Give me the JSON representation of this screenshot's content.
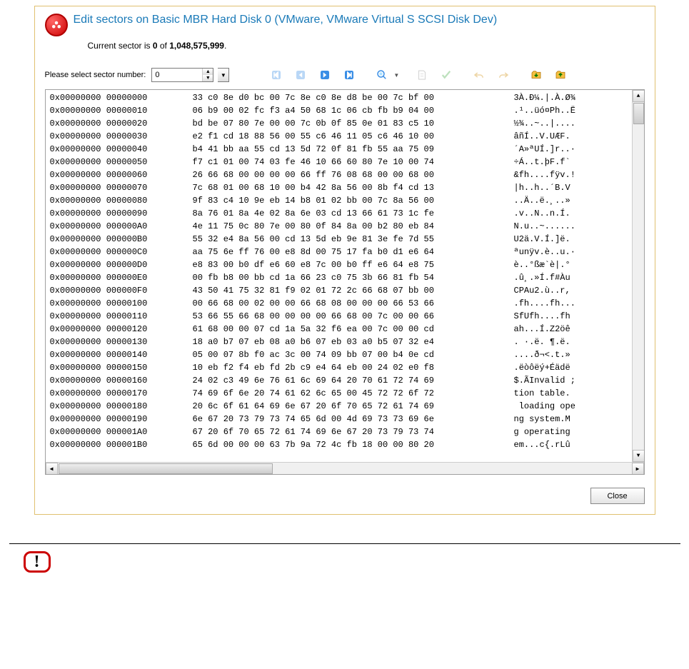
{
  "title": "Edit sectors on Basic MBR Hard Disk 0 (VMware, VMware Virtual S SCSI Disk Dev)",
  "subhead_prefix": "Current sector is ",
  "current_sector": "0",
  "subhead_middle": " of ",
  "total_sectors": "1,048,575,999",
  "subhead_suffix": ".",
  "sector_label": "Please select sector number:",
  "sector_value": "0",
  "close_label": "Close",
  "toolbar": {
    "first": "first-sector",
    "prev": "prev-sector",
    "next": "next-sector",
    "last": "last-sector",
    "search": "search",
    "edit": "edit",
    "apply": "apply",
    "undo": "undo",
    "redo": "redo",
    "load": "load-from-file",
    "save": "save-to-file"
  },
  "hex_rows": [
    {
      "addr": "0x00000000 00000000",
      "hex": "33 c0 8e d0 bc 00 7c 8e c0 8e d8 be 00 7c bf 00",
      "asc": "3À.Ð¼.|.À.Ø¾"
    },
    {
      "addr": "0x00000000 00000010",
      "hex": "06 b9 00 02 fc f3 a4 50 68 1c 06 cb fb b9 04 00",
      "asc": ".¹..üó¤Ph..Ë"
    },
    {
      "addr": "0x00000000 00000020",
      "hex": "bd be 07 80 7e 00 00 7c 0b 0f 85 0e 01 83 c5 10",
      "asc": "½¾..~..|...."
    },
    {
      "addr": "0x00000000 00000030",
      "hex": "e2 f1 cd 18 88 56 00 55 c6 46 11 05 c6 46 10 00",
      "asc": "âñÍ..V.UÆF."
    },
    {
      "addr": "0x00000000 00000040",
      "hex": "b4 41 bb aa 55 cd 13 5d 72 0f 81 fb 55 aa 75 09",
      "asc": "´A»ªUÍ.]r..·"
    },
    {
      "addr": "0x00000000 00000050",
      "hex": "f7 c1 01 00 74 03 fe 46 10 66 60 80 7e 10 00 74",
      "asc": "÷Á..t.þF.f`"
    },
    {
      "addr": "0x00000000 00000060",
      "hex": "26 66 68 00 00 00 00 66 ff 76 08 68 00 00 68 00",
      "asc": "&fh....fÿv.!"
    },
    {
      "addr": "0x00000000 00000070",
      "hex": "7c 68 01 00 68 10 00 b4 42 8a 56 00 8b f4 cd 13",
      "asc": "|h..h..´B.V"
    },
    {
      "addr": "0x00000000 00000080",
      "hex": "9f 83 c4 10 9e eb 14 b8 01 02 bb 00 7c 8a 56 00",
      "asc": "..Ä..ë.¸..»"
    },
    {
      "addr": "0x00000000 00000090",
      "hex": "8a 76 01 8a 4e 02 8a 6e 03 cd 13 66 61 73 1c fe",
      "asc": ".v..N..n.Í."
    },
    {
      "addr": "0x00000000 000000A0",
      "hex": "4e 11 75 0c 80 7e 00 80 0f 84 8a 00 b2 80 eb 84",
      "asc": "N.u..~......"
    },
    {
      "addr": "0x00000000 000000B0",
      "hex": "55 32 e4 8a 56 00 cd 13 5d eb 9e 81 3e fe 7d 55",
      "asc": "U2ä.V.Í.]ë."
    },
    {
      "addr": "0x00000000 000000C0",
      "hex": "aa 75 6e ff 76 00 e8 8d 00 75 17 fa b0 d1 e6 64",
      "asc": "ªunÿv.è..u.·"
    },
    {
      "addr": "0x00000000 000000D0",
      "hex": "e8 83 00 b0 df e6 60 e8 7c 00 b0 ff e6 64 e8 75",
      "asc": "è..°ßæ`è|.°"
    },
    {
      "addr": "0x00000000 000000E0",
      "hex": "00 fb b8 00 bb cd 1a 66 23 c0 75 3b 66 81 fb 54",
      "asc": ".û¸.»Í.f#Àu"
    },
    {
      "addr": "0x00000000 000000F0",
      "hex": "43 50 41 75 32 81 f9 02 01 72 2c 66 68 07 bb 00",
      "asc": "CPAu2.ù..r,"
    },
    {
      "addr": "0x00000000 00000100",
      "hex": "00 66 68 00 02 00 00 66 68 08 00 00 00 66 53 66",
      "asc": ".fh....fh..."
    },
    {
      "addr": "0x00000000 00000110",
      "hex": "53 66 55 66 68 00 00 00 00 66 68 00 7c 00 00 66",
      "asc": "SfUfh....fh"
    },
    {
      "addr": "0x00000000 00000120",
      "hex": "61 68 00 00 07 cd 1a 5a 32 f6 ea 00 7c 00 00 cd",
      "asc": "ah...Í.Z2öê"
    },
    {
      "addr": "0x00000000 00000130",
      "hex": "18 a0 b7 07 eb 08 a0 b6 07 eb 03 a0 b5 07 32 e4",
      "asc": ". ·.ë. ¶.ë."
    },
    {
      "addr": "0x00000000 00000140",
      "hex": "05 00 07 8b f0 ac 3c 00 74 09 bb 07 00 b4 0e cd",
      "asc": "....ð¬<.t.»"
    },
    {
      "addr": "0x00000000 00000150",
      "hex": "10 eb f2 f4 eb fd 2b c9 e4 64 eb 00 24 02 e0 f8",
      "asc": ".ëòôëý+Éädë"
    },
    {
      "addr": "0x00000000 00000160",
      "hex": "24 02 c3 49 6e 76 61 6c 69 64 20 70 61 72 74 69",
      "asc": "$.ÃInvalid ;"
    },
    {
      "addr": "0x00000000 00000170",
      "hex": "74 69 6f 6e 20 74 61 62 6c 65 00 45 72 72 6f 72",
      "asc": "tion table."
    },
    {
      "addr": "0x00000000 00000180",
      "hex": "20 6c 6f 61 64 69 6e 67 20 6f 70 65 72 61 74 69",
      "asc": " loading ope"
    },
    {
      "addr": "0x00000000 00000190",
      "hex": "6e 67 20 73 79 73 74 65 6d 00 4d 69 73 73 69 6e",
      "asc": "ng system.M"
    },
    {
      "addr": "0x00000000 000001A0",
      "hex": "67 20 6f 70 65 72 61 74 69 6e 67 20 73 79 73 74",
      "asc": "g operating"
    },
    {
      "addr": "0x00000000 000001B0",
      "hex": "65 6d 00 00 00 63 7b 9a 72 4c fb 18 00 00 80 20",
      "asc": "em...c{.rLû"
    }
  ]
}
